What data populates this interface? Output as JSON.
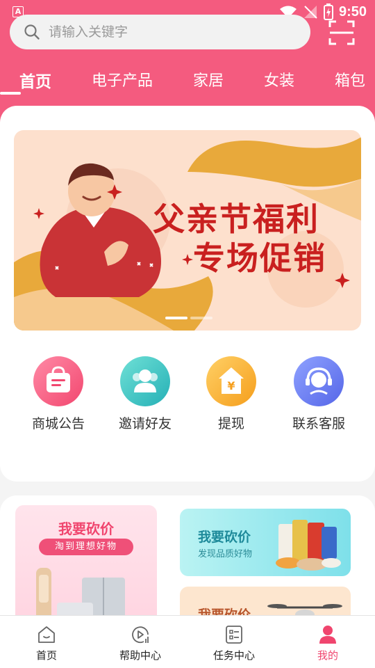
{
  "status_bar": {
    "time": "9:50",
    "left_badge": "A"
  },
  "search": {
    "placeholder": "请输入关键字"
  },
  "tabs": [
    {
      "label": "首页",
      "active": true
    },
    {
      "label": "电子产品"
    },
    {
      "label": "家居"
    },
    {
      "label": "女装"
    },
    {
      "label": "箱包"
    }
  ],
  "banner": {
    "line1": "父亲节福利",
    "line2": "专场促销"
  },
  "menu": [
    {
      "label": "商城公告",
      "icon": "announcement-bag-icon"
    },
    {
      "label": "邀请好友",
      "icon": "invite-friends-icon"
    },
    {
      "label": "提现",
      "icon": "withdraw-house-yen-icon"
    },
    {
      "label": "联系客服",
      "icon": "customer-service-headset-icon"
    }
  ],
  "promos": {
    "big": {
      "title": "我要砍价",
      "subtitle": "淘到理想好物"
    },
    "right1": {
      "title": "我要砍价",
      "subtitle": "发现品质好物"
    },
    "right2": {
      "title": "我要砍价"
    }
  },
  "bottom_nav": [
    {
      "label": "首页",
      "icon": "home-icon"
    },
    {
      "label": "帮助中心",
      "icon": "help-play-icon"
    },
    {
      "label": "任务中心",
      "icon": "task-list-icon"
    },
    {
      "label": "我的",
      "icon": "profile-icon",
      "active": true
    }
  ],
  "colors": {
    "brand": "#f45b7f",
    "active_nav": "#f0456e",
    "banner_text": "#c9201f"
  }
}
